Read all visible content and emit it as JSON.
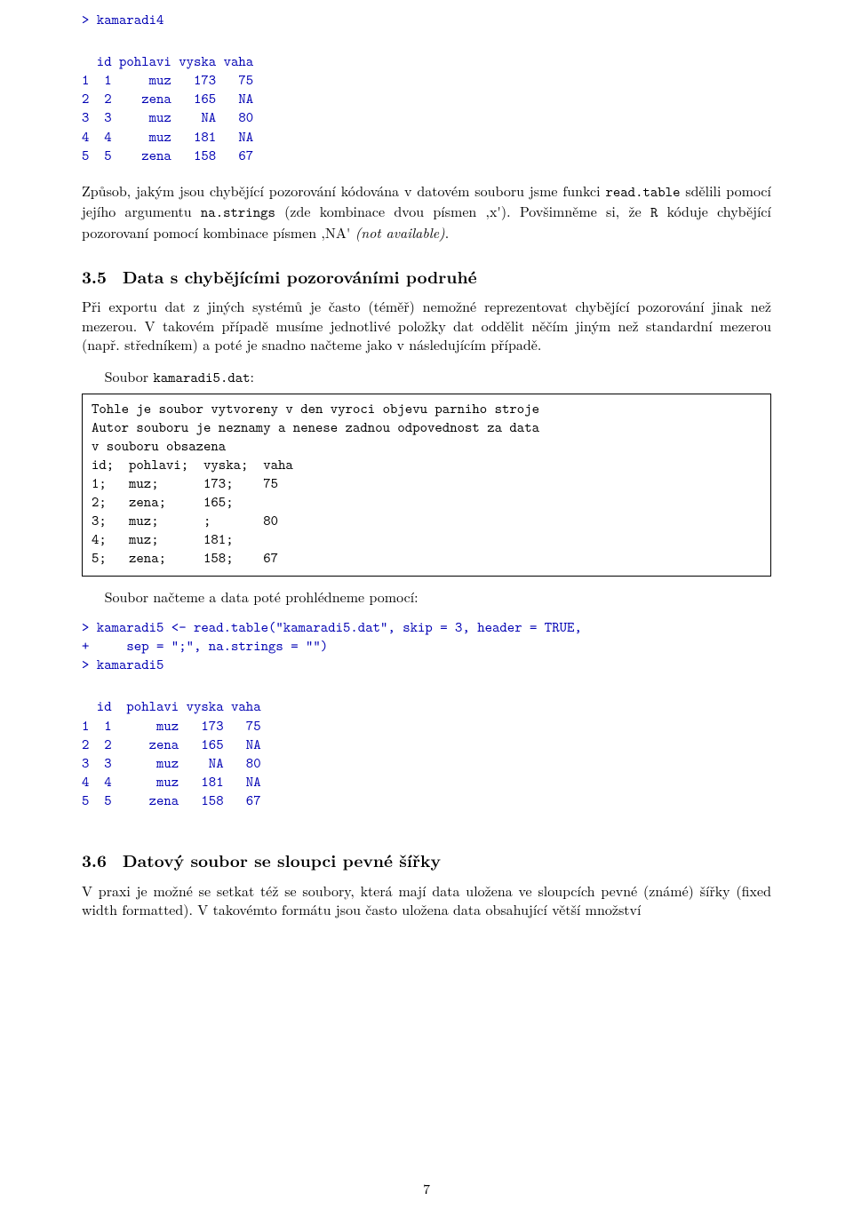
{
  "code1": "> kamaradi4",
  "table1": "  id pohlavi vyska vaha\n1  1     muz   173   75\n2  2    zena   165   NA\n3  3     muz    NA   80\n4  4     muz   181   NA\n5  5    zena   158   67",
  "para1_a": "Způsob, jakým jsou chybějící pozorování kódována v datovém souboru jsme funkci ",
  "para1_tt1": "read.table",
  "para1_b": " sdělili pomocí jejího argumentu ",
  "para1_tt2": "na.strings",
  "para1_c": " (zde kombinace dvou písmen ‚x'). Povšimněme si, že ",
  "para1_tt3": "R",
  "para1_d": " kóduje chybějící pozorovaní pomocí kombinace písmen ‚NA' ",
  "para1_it": "(not available)",
  "para1_e": ".",
  "sec35_num": "3.5",
  "sec35_title": "Data s chybějícími pozorováními podruhé",
  "para2": "Při exportu dat z jiných systémů je často (téměř) nemožné reprezentovat chybějící pozorování jinak než mezerou. V takovém případě musíme jednotlivé položky dat oddělit něčím jiným než standardní mezerou (např. středníkem) a poté je snadno načteme jako v následujícím případě.",
  "soubor5_a": "Soubor ",
  "soubor5_tt": "kamaradi5.dat",
  "soubor5_b": ":",
  "box5": "Tohle je soubor vytvoreny v den vyroci objevu parniho stroje\nAutor souboru je neznamy a nenese zadnou odpovednost za data\nv souboru obsazena\nid;  pohlavi;  vyska;  vaha\n1;   muz;      173;    75\n2;   zena;     165;\n3;   muz;      ;       80\n4;   muz;      181;\n5;   zena;     158;    67",
  "para3": "Soubor načteme a data poté prohlédneme pomocí:",
  "code2": "> kamaradi5 <- read.table(\"kamaradi5.dat\", skip = 3, header = TRUE,\n+     sep = \";\", na.strings = \"\")\n> kamaradi5",
  "table2": "  id  pohlavi vyska vaha\n1  1      muz   173   75\n2  2     zena   165   NA\n3  3      muz    NA   80\n4  4      muz   181   NA\n5  5     zena   158   67",
  "sec36_num": "3.6",
  "sec36_title": "Datový soubor se sloupci pevné šířky",
  "para4": "V praxi je možné se setkat též se soubory, která mají data uložena ve sloupcích pevné (známé) šířky (fixed width formatted). V takovémto formátu jsou často uložena data obsahující větší množství",
  "page_number": "7"
}
